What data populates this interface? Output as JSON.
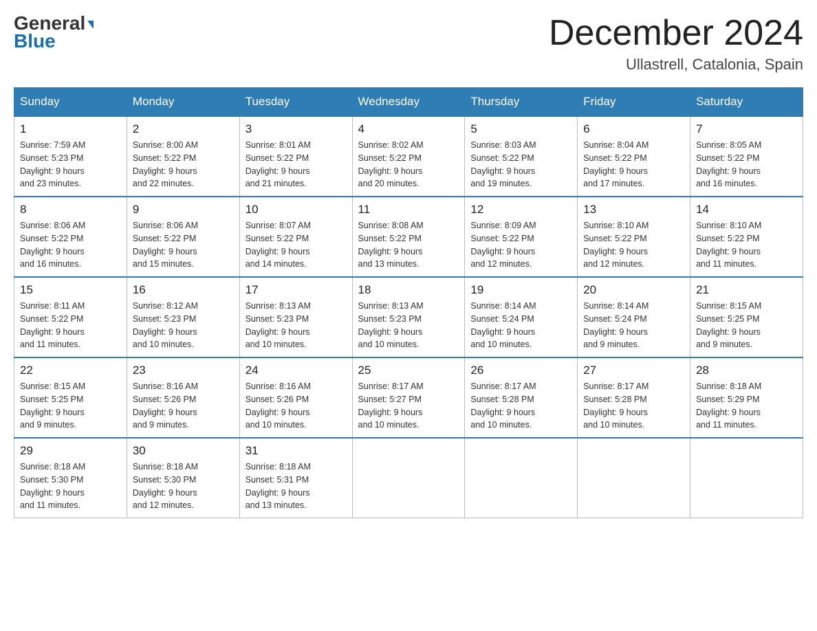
{
  "logo": {
    "text1": "General",
    "text2": "Blue"
  },
  "title": "December 2024",
  "subtitle": "Ullastrell, Catalonia, Spain",
  "weekdays": [
    "Sunday",
    "Monday",
    "Tuesday",
    "Wednesday",
    "Thursday",
    "Friday",
    "Saturday"
  ],
  "weeks": [
    [
      {
        "day": "1",
        "sunrise": "7:59 AM",
        "sunset": "5:23 PM",
        "daylight": "9 hours and 23 minutes."
      },
      {
        "day": "2",
        "sunrise": "8:00 AM",
        "sunset": "5:22 PM",
        "daylight": "9 hours and 22 minutes."
      },
      {
        "day": "3",
        "sunrise": "8:01 AM",
        "sunset": "5:22 PM",
        "daylight": "9 hours and 21 minutes."
      },
      {
        "day": "4",
        "sunrise": "8:02 AM",
        "sunset": "5:22 PM",
        "daylight": "9 hours and 20 minutes."
      },
      {
        "day": "5",
        "sunrise": "8:03 AM",
        "sunset": "5:22 PM",
        "daylight": "9 hours and 19 minutes."
      },
      {
        "day": "6",
        "sunrise": "8:04 AM",
        "sunset": "5:22 PM",
        "daylight": "9 hours and 17 minutes."
      },
      {
        "day": "7",
        "sunrise": "8:05 AM",
        "sunset": "5:22 PM",
        "daylight": "9 hours and 16 minutes."
      }
    ],
    [
      {
        "day": "8",
        "sunrise": "8:06 AM",
        "sunset": "5:22 PM",
        "daylight": "9 hours and 16 minutes."
      },
      {
        "day": "9",
        "sunrise": "8:06 AM",
        "sunset": "5:22 PM",
        "daylight": "9 hours and 15 minutes."
      },
      {
        "day": "10",
        "sunrise": "8:07 AM",
        "sunset": "5:22 PM",
        "daylight": "9 hours and 14 minutes."
      },
      {
        "day": "11",
        "sunrise": "8:08 AM",
        "sunset": "5:22 PM",
        "daylight": "9 hours and 13 minutes."
      },
      {
        "day": "12",
        "sunrise": "8:09 AM",
        "sunset": "5:22 PM",
        "daylight": "9 hours and 12 minutes."
      },
      {
        "day": "13",
        "sunrise": "8:10 AM",
        "sunset": "5:22 PM",
        "daylight": "9 hours and 12 minutes."
      },
      {
        "day": "14",
        "sunrise": "8:10 AM",
        "sunset": "5:22 PM",
        "daylight": "9 hours and 11 minutes."
      }
    ],
    [
      {
        "day": "15",
        "sunrise": "8:11 AM",
        "sunset": "5:22 PM",
        "daylight": "9 hours and 11 minutes."
      },
      {
        "day": "16",
        "sunrise": "8:12 AM",
        "sunset": "5:23 PM",
        "daylight": "9 hours and 10 minutes."
      },
      {
        "day": "17",
        "sunrise": "8:13 AM",
        "sunset": "5:23 PM",
        "daylight": "9 hours and 10 minutes."
      },
      {
        "day": "18",
        "sunrise": "8:13 AM",
        "sunset": "5:23 PM",
        "daylight": "9 hours and 10 minutes."
      },
      {
        "day": "19",
        "sunrise": "8:14 AM",
        "sunset": "5:24 PM",
        "daylight": "9 hours and 10 minutes."
      },
      {
        "day": "20",
        "sunrise": "8:14 AM",
        "sunset": "5:24 PM",
        "daylight": "9 hours and 9 minutes."
      },
      {
        "day": "21",
        "sunrise": "8:15 AM",
        "sunset": "5:25 PM",
        "daylight": "9 hours and 9 minutes."
      }
    ],
    [
      {
        "day": "22",
        "sunrise": "8:15 AM",
        "sunset": "5:25 PM",
        "daylight": "9 hours and 9 minutes."
      },
      {
        "day": "23",
        "sunrise": "8:16 AM",
        "sunset": "5:26 PM",
        "daylight": "9 hours and 9 minutes."
      },
      {
        "day": "24",
        "sunrise": "8:16 AM",
        "sunset": "5:26 PM",
        "daylight": "9 hours and 10 minutes."
      },
      {
        "day": "25",
        "sunrise": "8:17 AM",
        "sunset": "5:27 PM",
        "daylight": "9 hours and 10 minutes."
      },
      {
        "day": "26",
        "sunrise": "8:17 AM",
        "sunset": "5:28 PM",
        "daylight": "9 hours and 10 minutes."
      },
      {
        "day": "27",
        "sunrise": "8:17 AM",
        "sunset": "5:28 PM",
        "daylight": "9 hours and 10 minutes."
      },
      {
        "day": "28",
        "sunrise": "8:18 AM",
        "sunset": "5:29 PM",
        "daylight": "9 hours and 11 minutes."
      }
    ],
    [
      {
        "day": "29",
        "sunrise": "8:18 AM",
        "sunset": "5:30 PM",
        "daylight": "9 hours and 11 minutes."
      },
      {
        "day": "30",
        "sunrise": "8:18 AM",
        "sunset": "5:30 PM",
        "daylight": "9 hours and 12 minutes."
      },
      {
        "day": "31",
        "sunrise": "8:18 AM",
        "sunset": "5:31 PM",
        "daylight": "9 hours and 13 minutes."
      },
      null,
      null,
      null,
      null
    ]
  ],
  "labels": {
    "sunrise": "Sunrise:",
    "sunset": "Sunset:",
    "daylight": "Daylight:"
  }
}
